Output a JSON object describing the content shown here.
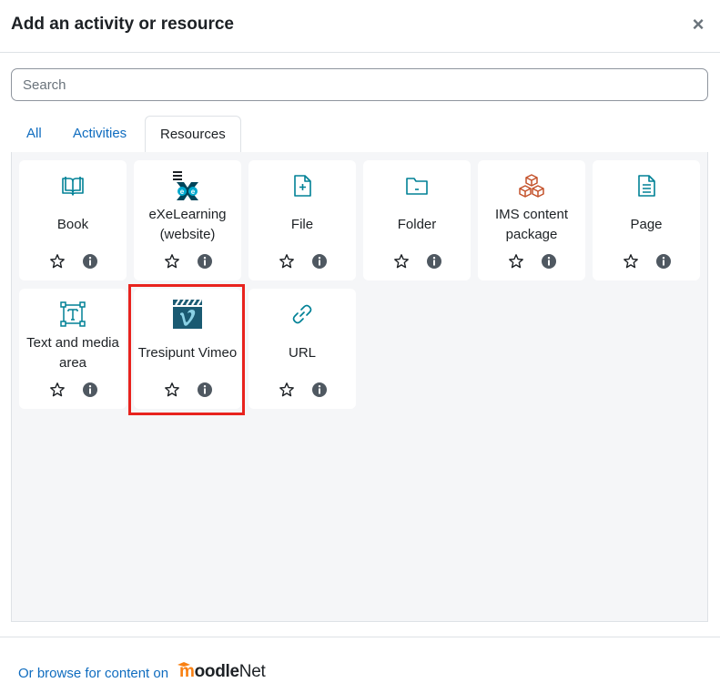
{
  "dialog": {
    "title": "Add an activity or resource",
    "close_symbol": "×"
  },
  "search": {
    "placeholder": "Search",
    "value": ""
  },
  "tabs": [
    {
      "label": "All",
      "active": false
    },
    {
      "label": "Activities",
      "active": false
    },
    {
      "label": "Resources",
      "active": true
    }
  ],
  "items": [
    {
      "label": "Book",
      "icon": "book-icon",
      "color": "#008196"
    },
    {
      "label": "eXeLearning (website)",
      "icon": "exelearning-icon",
      "color": "#00a9ce"
    },
    {
      "label": "File",
      "icon": "file-icon",
      "color": "#008196"
    },
    {
      "label": "Folder",
      "icon": "folder-icon",
      "color": "#008196"
    },
    {
      "label": "IMS content package",
      "icon": "ims-package-icon",
      "color": "#c4522b"
    },
    {
      "label": "Page",
      "icon": "page-icon",
      "color": "#008196"
    },
    {
      "label": "Text and media area",
      "icon": "text-media-icon",
      "color": "#008196"
    },
    {
      "label": "Tresipunt Vimeo",
      "icon": "vimeo-icon",
      "color": "#1a5a72"
    },
    {
      "label": "URL",
      "icon": "link-icon",
      "color": "#008196"
    }
  ],
  "highlighted_item": "Tresipunt Vimeo",
  "highlight_color": "#e8231e",
  "footer": {
    "browse_text": "Or browse for content on",
    "logo_moodle": "moodle",
    "logo_net": "Net"
  },
  "colors": {
    "link": "#0f6cbf",
    "text": "#1d2125",
    "panel_bg": "#f5f6f8"
  }
}
